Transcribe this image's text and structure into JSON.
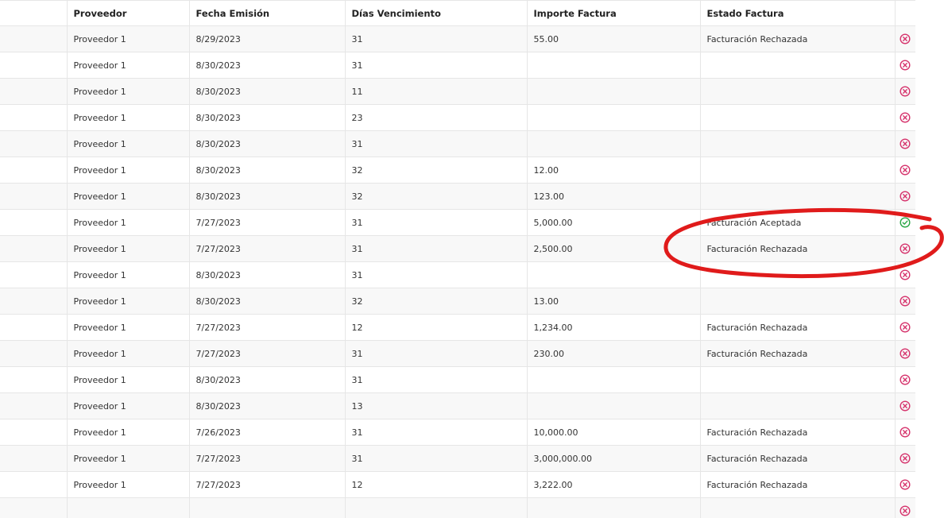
{
  "table": {
    "headers": [
      "",
      "Proveedor",
      "Fecha Emisión",
      "Días Vencimiento",
      "Importe Factura",
      "Estado Factura",
      ""
    ],
    "rows": [
      {
        "proveedor": "Proveedor 1",
        "fecha": "8/29/2023",
        "dias": "31",
        "importe": "55.00",
        "estado": "Facturación Rechazada",
        "icon": "reject-icon"
      },
      {
        "proveedor": "Proveedor 1",
        "fecha": "8/30/2023",
        "dias": "31",
        "importe": "",
        "estado": "",
        "icon": "reject-icon"
      },
      {
        "proveedor": "Proveedor 1",
        "fecha": "8/30/2023",
        "dias": "11",
        "importe": "",
        "estado": "",
        "icon": "reject-icon"
      },
      {
        "proveedor": "Proveedor 1",
        "fecha": "8/30/2023",
        "dias": "23",
        "importe": "",
        "estado": "",
        "icon": "reject-icon"
      },
      {
        "proveedor": "Proveedor 1",
        "fecha": "8/30/2023",
        "dias": "31",
        "importe": "",
        "estado": "",
        "icon": "reject-icon"
      },
      {
        "proveedor": "Proveedor 1",
        "fecha": "8/30/2023",
        "dias": "32",
        "importe": "12.00",
        "estado": "",
        "icon": "reject-icon"
      },
      {
        "proveedor": "Proveedor 1",
        "fecha": "8/30/2023",
        "dias": "32",
        "importe": "123.00",
        "estado": "",
        "icon": "reject-icon"
      },
      {
        "proveedor": "Proveedor 1",
        "fecha": "7/27/2023",
        "dias": "31",
        "importe": "5,000.00",
        "estado": "Facturación Aceptada",
        "icon": "accept-icon"
      },
      {
        "proveedor": "Proveedor 1",
        "fecha": "7/27/2023",
        "dias": "31",
        "importe": "2,500.00",
        "estado": "Facturación Rechazada",
        "icon": "reject-icon"
      },
      {
        "proveedor": "Proveedor 1",
        "fecha": "8/30/2023",
        "dias": "31",
        "importe": "",
        "estado": "",
        "icon": "reject-icon"
      },
      {
        "proveedor": "Proveedor 1",
        "fecha": "8/30/2023",
        "dias": "32",
        "importe": "13.00",
        "estado": "",
        "icon": "reject-icon"
      },
      {
        "proveedor": "Proveedor 1",
        "fecha": "7/27/2023",
        "dias": "12",
        "importe": "1,234.00",
        "estado": "Facturación Rechazada",
        "icon": "reject-icon"
      },
      {
        "proveedor": "Proveedor 1",
        "fecha": "7/27/2023",
        "dias": "31",
        "importe": "230.00",
        "estado": "Facturación Rechazada",
        "icon": "reject-icon"
      },
      {
        "proveedor": "Proveedor 1",
        "fecha": "8/30/2023",
        "dias": "31",
        "importe": "",
        "estado": "",
        "icon": "reject-icon"
      },
      {
        "proveedor": "Proveedor 1",
        "fecha": "8/30/2023",
        "dias": "13",
        "importe": "",
        "estado": "",
        "icon": "reject-icon"
      },
      {
        "proveedor": "Proveedor 1",
        "fecha": "7/26/2023",
        "dias": "31",
        "importe": "10,000.00",
        "estado": "Facturación Rechazada",
        "icon": "reject-icon"
      },
      {
        "proveedor": "Proveedor 1",
        "fecha": "7/27/2023",
        "dias": "31",
        "importe": "3,000,000.00",
        "estado": "Facturación Rechazada",
        "icon": "reject-icon"
      },
      {
        "proveedor": "Proveedor 1",
        "fecha": "7/27/2023",
        "dias": "12",
        "importe": "3,222.00",
        "estado": "Facturación Rechazada",
        "icon": "reject-icon"
      },
      {
        "proveedor": "",
        "fecha": "",
        "dias": "",
        "importe": "",
        "estado": "",
        "icon": "reject-icon"
      }
    ]
  },
  "colors": {
    "reject": "#d6336c",
    "accept": "#28a745",
    "annotation": "#e01b1b",
    "border": "#e6e6e6",
    "stripe": "#f8f8f8"
  }
}
